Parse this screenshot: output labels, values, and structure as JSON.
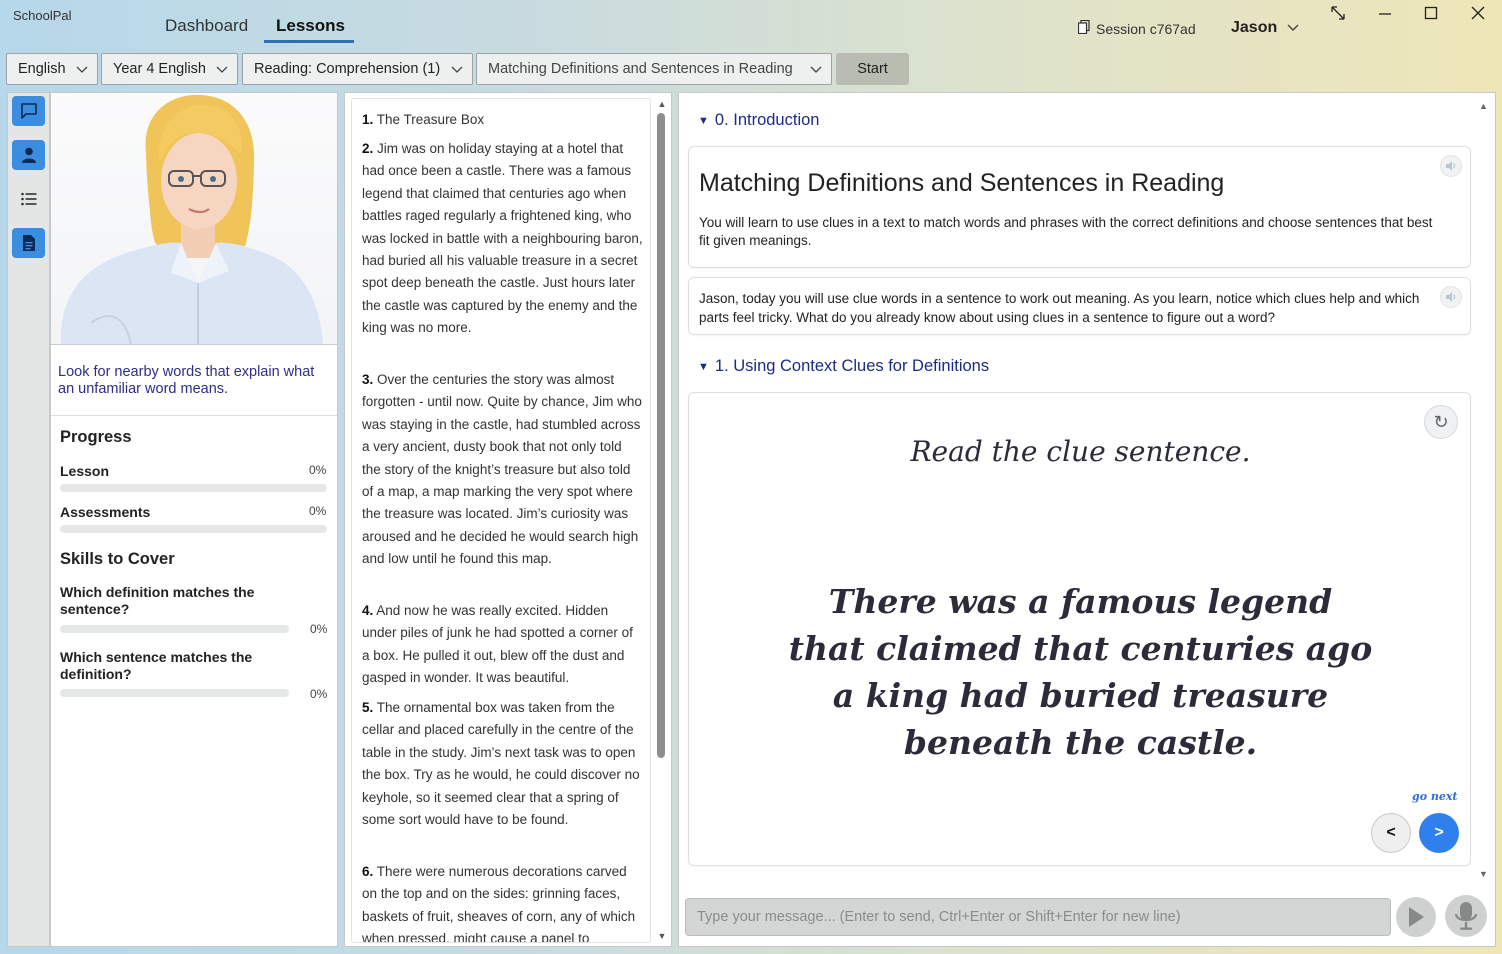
{
  "app": {
    "name": "SchoolPal",
    "nav": {
      "dashboard": "Dashboard",
      "lessons": "Lessons"
    },
    "session": "Session c767ad",
    "user": "Jason"
  },
  "toolbar": {
    "subject": "English",
    "year": "Year 4 English",
    "topic": "Reading: Comprehension (1)",
    "lesson": "Matching Definitions and Sentences in Reading",
    "start_label": "Start"
  },
  "tutor": {
    "tip": "Look for nearby words that explain what an unfamiliar word means.",
    "progress_title": "Progress",
    "progress": [
      {
        "label": "Lesson",
        "percent_text": "0%",
        "value": 0
      },
      {
        "label": "Assessments",
        "percent_text": "0%",
        "value": 0
      }
    ],
    "skills_title": "Skills to Cover",
    "skills": [
      {
        "label": "Which definition matches the sentence?",
        "percent_text": "0%",
        "value": 0
      },
      {
        "label": "Which sentence matches the definition?",
        "percent_text": "0%",
        "value": 0
      }
    ]
  },
  "reading": {
    "paragraphs": [
      {
        "num": "1.",
        "text": "The Treasure Box"
      },
      {
        "num": "2.",
        "text": "Jim was on holiday staying at a hotel that had once been a castle. There was a famous legend that claimed that centuries ago when battles raged regularly a frightened king, who was locked in battle with a neighbouring baron, had buried all his valuable treasure in a secret spot deep beneath the castle. Just hours later the castle was captured by the enemy and the king was no more."
      },
      {
        "num": "3.",
        "text": "Over the centuries the story was almost forgotten - until now. Quite by chance, Jim who was staying in the castle, had stumbled across a very ancient, dusty book that not only told the story of the knight’s treasure but also told of a map, a map marking the very spot where the treasure was located. Jim’s curiosity was aroused and he decided he would search high and low until he found this map."
      },
      {
        "num": "4.",
        "text": "And now he was really excited. Hidden under piles of junk he had spotted a corner of a box. He pulled it out, blew off the dust and gasped in wonder. It was beautiful."
      },
      {
        "num": "5.",
        "text": "The ornamental box was taken from the cellar and placed carefully in the centre of the table in the study. Jim’s next task was to open the box. Try as he would, he could discover no keyhole, so it seemed clear that a spring of some sort would have to be found."
      },
      {
        "num": "6.",
        "text": "There were numerous decorations carved on the top and on the sides: grinning faces, baskets of fruit, sheaves of corn, any of which when pressed, might cause a panel to"
      }
    ]
  },
  "lesson": {
    "sections": [
      {
        "label": "0. Introduction"
      },
      {
        "label": "1. Using Context Clues for Definitions"
      }
    ],
    "intro_title": "Matching Definitions and Sentences in Reading",
    "intro_desc": "You will learn to use clues in a text to match words and phrases with the correct definitions and choose sentences that best fit given meanings.",
    "intro_message": "Jason, today you will use clue words in a sentence to work out meaning. As you learn, notice which clues help and which parts feel tricky. What do you already know about using clues in a sentence to figure out a word?",
    "slide": {
      "heading": "Read the clue sentence.",
      "lines": [
        "There was a famous legend",
        "that claimed that centuries ago",
        "a king had buried treasure",
        "beneath the castle."
      ],
      "go_next": "go next",
      "prev_label": "<",
      "next_label": ">"
    }
  },
  "composer": {
    "placeholder": "Type your message... (Enter to send, Ctrl+Enter or Shift+Enter for new line)"
  },
  "colors": {
    "accent": "#2f80ed",
    "section_heading": "#1c2b86",
    "tip_text": "#2d2d8a",
    "tab_underline": "#2f6fb6"
  },
  "icons": [
    "chat-icon",
    "person-icon",
    "list-icon",
    "document-icon",
    "copy-icon",
    "chevron-down-icon",
    "speaker-icon",
    "refresh-icon",
    "play-icon",
    "microphone-icon"
  ]
}
